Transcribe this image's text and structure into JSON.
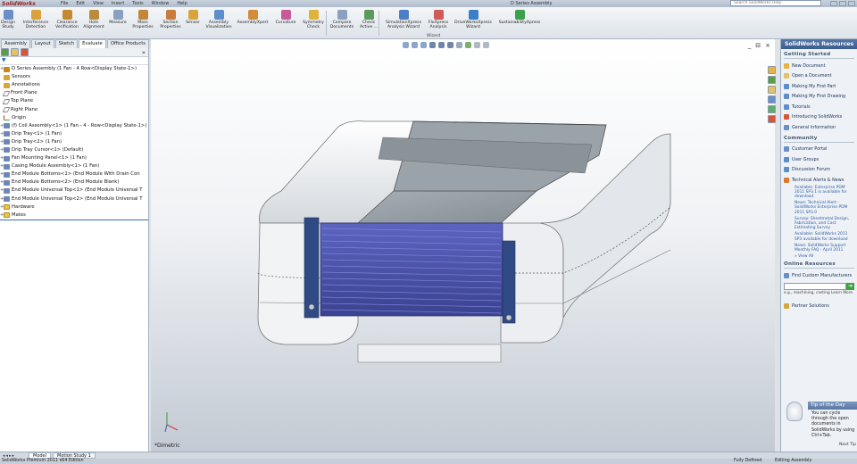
{
  "titlebar": {
    "app_logo": "SolidWorks",
    "menus": [
      "File",
      "Edit",
      "View",
      "Insert",
      "Tools",
      "Window",
      "Help"
    ],
    "document_title": "D Series Assembly",
    "search_placeholder": "Search SolidWorks Help"
  },
  "ribbon": {
    "buttons": [
      {
        "label": "Design Study",
        "icon": "design-study-icon",
        "color": "#6a8fc8"
      },
      {
        "label": "Interference Detection",
        "icon": "interference-icon",
        "color": "#d9a23a"
      },
      {
        "label": "Clearance Verification",
        "icon": "clearance-icon",
        "color": "#c48a2f"
      },
      {
        "label": "Hole Alignment",
        "icon": "hole-icon",
        "color": "#b98c3c"
      },
      {
        "label": "Measure",
        "icon": "measure-icon",
        "color": "#8aa0bf"
      },
      {
        "label": "Mass Properties",
        "icon": "mass-icon",
        "color": "#c2873a"
      },
      {
        "label": "Section Properties",
        "icon": "section-icon",
        "color": "#c87b3e"
      },
      {
        "label": "Sensor",
        "icon": "sensor-icon",
        "color": "#d8a53a"
      },
      {
        "label": "Assembly Visualization",
        "icon": "visualization-icon",
        "color": "#5c8ecb"
      },
      {
        "label": "AssemblyXpert",
        "icon": "assemblyxpert-icon",
        "color": "#d28b3a"
      },
      {
        "label": "Curvature",
        "icon": "curvature-icon",
        "color": "#c75a9a"
      },
      {
        "label": "Symmetry Check",
        "icon": "symmetry-icon",
        "color": "#e0b43a"
      },
      {
        "label": "Compare Documents",
        "icon": "compare-icon",
        "color": "#8aa0bf"
      },
      {
        "label": "Check Active ...",
        "icon": "check-icon",
        "color": "#5c9a5c"
      },
      {
        "label": "SimulationXpress Analysis Wizard",
        "icon": "simxpress-icon",
        "color": "#4e7fc4"
      },
      {
        "label": "FloXpress Analysis",
        "icon": "floxpress-icon",
        "color": "#d05a5a"
      },
      {
        "label": "DriveWorksXpress Wizard",
        "icon": "driveworks-icon",
        "color": "#3a7fc8"
      },
      {
        "label": "SustainabilityXpress",
        "icon": "sustainability-icon",
        "color": "#3aa04a"
      }
    ],
    "group_label": "Wizard"
  },
  "left_tabs": [
    "Assembly",
    "Layout",
    "Sketch",
    "Evaluate",
    "Office Products"
  ],
  "active_left_tab": "Evaluate",
  "tree": [
    {
      "label": "D Series Assembly  (1 Fan - 4 Row<Display State-1>)",
      "kind": "root"
    },
    {
      "label": "Sensors",
      "kind": "sensor"
    },
    {
      "label": "Annotations",
      "kind": "sensor"
    },
    {
      "label": "Front Plane",
      "kind": "plane"
    },
    {
      "label": "Top Plane",
      "kind": "plane"
    },
    {
      "label": "Right Plane",
      "kind": "plane"
    },
    {
      "label": "Origin",
      "kind": "origin"
    },
    {
      "label": "(f) Coil Assembly<1> (1 Fan - 4 - Row<Display State-1>)",
      "kind": "comp"
    },
    {
      "label": "Drip Tray<1> (1 Fan)",
      "kind": "comp"
    },
    {
      "label": "Drip Tray<2> (1 Fan)",
      "kind": "comp"
    },
    {
      "label": "Drip Tray Cursor<1> (Default)",
      "kind": "comp"
    },
    {
      "label": "Fan Mounting Panel<1> (1 Fan)",
      "kind": "comp"
    },
    {
      "label": "Casing Module Assembly<1> (1 Fan)",
      "kind": "comp"
    },
    {
      "label": "End Module Bottoms<1> (End Module With Drain Con",
      "kind": "comp"
    },
    {
      "label": "End Module Bottoms<2> (End Module Blank)",
      "kind": "comp"
    },
    {
      "label": "End Module Universal Top<1> (End Module Universal T",
      "kind": "comp"
    },
    {
      "label": "End Module Universal Top<2> (End Module Universal T",
      "kind": "comp"
    },
    {
      "label": "Hardware",
      "kind": "folder"
    },
    {
      "label": "Mates",
      "kind": "folder"
    }
  ],
  "graphics": {
    "view_label": "*Dimetric"
  },
  "resources": {
    "title": "SolidWorks Resources",
    "getting_started_title": "Getting Started",
    "getting_started": [
      "New Document",
      "Open a Document",
      "Making My First Part",
      "Making My First Drawing",
      "Tutorials",
      "Introducing SolidWorks",
      "General Information"
    ],
    "community_title": "Community",
    "community": [
      "Customer Portal",
      "User Groups",
      "Discussion Forum",
      "Technical Alerts & News"
    ],
    "news": [
      {
        "head": "Available: Enterprise PDM 2011 SP3.1 is available for download",
        "sub": ""
      },
      {
        "head": "News: Technical Alert - SolidWorks Enterprise PDM 2011 SP3.0",
        "sub": ""
      },
      {
        "head": "Survey: Sheetmetal Design, Fabrication, and Cost Estimating Survey",
        "sub": ""
      },
      {
        "head": "Available: SolidWorks 2011 SP3 available for download",
        "sub": ""
      },
      {
        "head": "News: SolidWorks Support Monthly FAQ - April 2011",
        "sub": ""
      }
    ],
    "view_all": "» View All",
    "online_title": "Online Resources",
    "online_item": "Find Custom Manufacturers",
    "online_example": "e.g., machining, casting   Learn More",
    "partner": "Partner Solutions",
    "tip_title": "Tip of the Day",
    "tip_body": "You can cycle through the open documents in SolidWorks by using Ctrl+Tab.",
    "next_tip": "Next Tip"
  },
  "bottom_tabs": [
    "Model",
    "Motion Study 1"
  ],
  "status": {
    "left": "SolidWorks Premium 2011 x64 Edition",
    "editing": "Fully Defined",
    "mode": "Editing Assembly"
  },
  "colors": {
    "coil_blue": "#4850a8",
    "frame_blue": "#2f4a84",
    "panel_gray": "#8f98a0",
    "casing_white": "#f4f5f6",
    "header_blue": "#3b5d8e"
  }
}
